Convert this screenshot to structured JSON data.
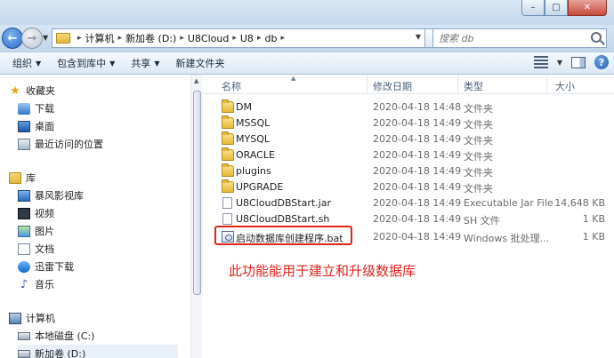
{
  "window": {
    "minimize_label": "–",
    "maximize_label": "□",
    "close_label": "✕"
  },
  "address": {
    "crumbs": [
      "计算机",
      "新加卷 (D:)",
      "U8Cloud",
      "U8",
      "db"
    ],
    "separator": "▸"
  },
  "search": {
    "placeholder": "搜索 db"
  },
  "toolbar": {
    "organize": "组织",
    "include_library": "包含到库中",
    "share": "共享",
    "new_folder": "新建文件夹"
  },
  "navpane": {
    "favorites": "收藏夹",
    "favorites_items": [
      "下载",
      "桌面",
      "最近访问的位置"
    ],
    "libraries": "库",
    "libraries_items": [
      "暴风影视库",
      "视频",
      "图片",
      "文档",
      "迅雷下载",
      "音乐"
    ],
    "computer": "计算机",
    "computer_items": [
      "本地磁盘 (C:)",
      "新加卷 (D:)"
    ]
  },
  "columns": {
    "name": "名称",
    "date": "修改日期",
    "type": "类型",
    "size": "大小"
  },
  "files": [
    {
      "name": "DM",
      "date": "2020-04-18 14:48",
      "type": "文件夹",
      "size": "",
      "kind": "folder"
    },
    {
      "name": "MSSQL",
      "date": "2020-04-18 14:49",
      "type": "文件夹",
      "size": "",
      "kind": "folder"
    },
    {
      "name": "MYSQL",
      "date": "2020-04-18 14:49",
      "type": "文件夹",
      "size": "",
      "kind": "folder"
    },
    {
      "name": "ORACLE",
      "date": "2020-04-18 14:49",
      "type": "文件夹",
      "size": "",
      "kind": "folder"
    },
    {
      "name": "plugins",
      "date": "2020-04-18 14:49",
      "type": "文件夹",
      "size": "",
      "kind": "folder"
    },
    {
      "name": "UPGRADE",
      "date": "2020-04-18 14:49",
      "type": "文件夹",
      "size": "",
      "kind": "folder"
    },
    {
      "name": "U8CloudDBStart.jar",
      "date": "2020-04-18 14:49",
      "type": "Executable Jar File",
      "size": "14,648 KB",
      "kind": "file"
    },
    {
      "name": "U8CloudDBStart.sh",
      "date": "2020-04-18 14:49",
      "type": "SH 文件",
      "size": "1 KB",
      "kind": "file"
    },
    {
      "name": "启动数据库创建程序.bat",
      "date": "2020-04-18 14:49",
      "type": "Windows 批处理...",
      "size": "1 KB",
      "kind": "bat"
    }
  ],
  "annotation": {
    "text": "此功能能用于建立和升级数据库",
    "color": "#e2231a"
  },
  "colors": {
    "chrome": "#c5d8ec",
    "highlight": "#e2231a"
  }
}
